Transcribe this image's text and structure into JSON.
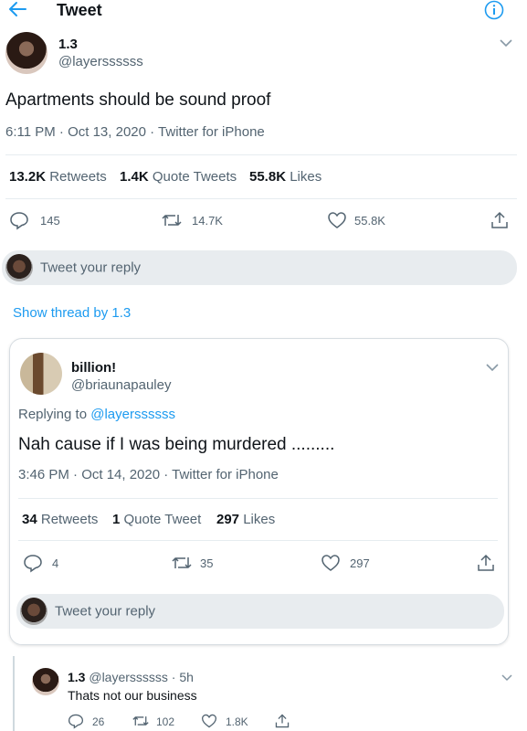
{
  "header": {
    "title": "Tweet",
    "back_icon": "arrow-left-icon",
    "info_icon": "info-icon"
  },
  "main_tweet": {
    "name": "1.3",
    "handle": "@layerssssss",
    "text": "Apartments should be sound proof",
    "timestamp": "6:11 PM · Oct 13, 2020 · Twitter for iPhone",
    "retweets_count": "13.2K",
    "retweets_label": "Retweets",
    "quotes_count": "1.4K",
    "quotes_label": "Quote Tweets",
    "likes_count": "55.8K",
    "likes_label": "Likes",
    "actions": {
      "reply": "145",
      "retweet": "14.7K",
      "like": "55.8K"
    }
  },
  "reply_box": {
    "placeholder": "Tweet your reply"
  },
  "show_thread": "Show thread by 1.3",
  "reply_tweet": {
    "name": "billion!",
    "handle": "@briaunapauley",
    "replying_prefix": "Replying to",
    "replying_to": "@layerssssss",
    "text": "Nah cause if I was being murdered .........",
    "timestamp": "3:46 PM · Oct 14, 2020 · Twitter for iPhone",
    "retweets_count": "34",
    "retweets_label": "Retweets",
    "quotes_count": "1",
    "quotes_label": "Quote Tweet",
    "likes_count": "297",
    "likes_label": "Likes",
    "actions": {
      "reply": "4",
      "retweet": "35",
      "like": "297"
    },
    "reply_placeholder": "Tweet your reply"
  },
  "nested_reply": {
    "name": "1.3",
    "meta": "@layerssssss · 5h",
    "text": "Thats not our business",
    "actions": {
      "reply": "26",
      "retweet": "102",
      "like": "1.8K"
    }
  },
  "colors": {
    "accent": "#1d9bf0",
    "text": "#0f1419",
    "secondary": "#536471",
    "reply_bg": "#e8ecef"
  }
}
